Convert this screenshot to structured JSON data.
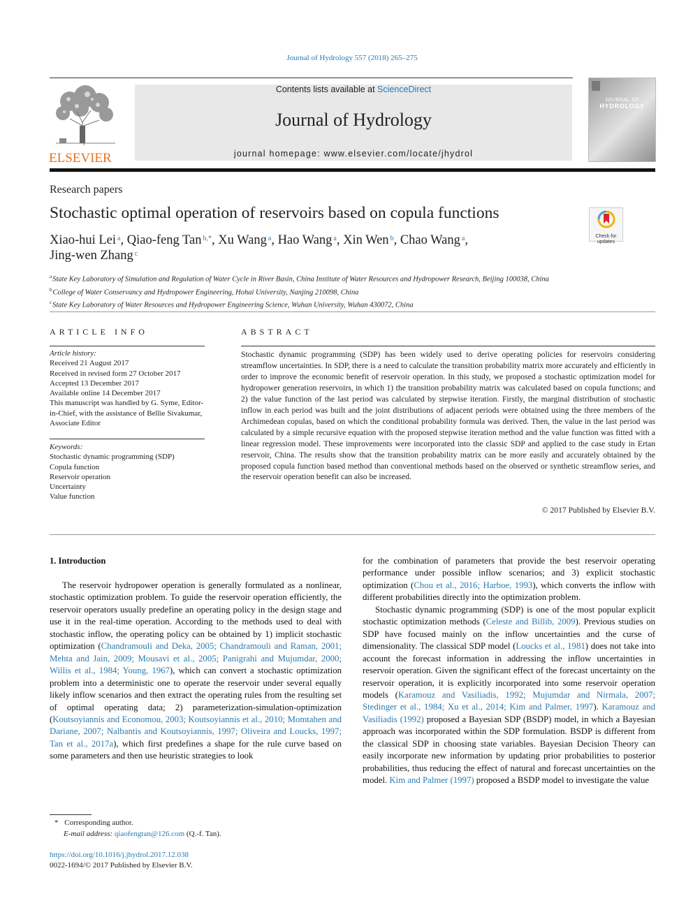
{
  "header": {
    "journal_ref": "Journal of Hydrology 557 (2018) 265–275",
    "contents_prefix": "Contents lists available at ",
    "contents_link": "ScienceDirect",
    "journal_title": "Journal of Hydrology",
    "homepage_prefix": "journal homepage: ",
    "homepage_url": "www.elsevier.com/locate/jhydrol",
    "publisher_logo_text": "ELSEVIER",
    "cover_title_line1": "JOURNAL OF",
    "cover_title_line2": "HYDROLOGY"
  },
  "article": {
    "section": "Research papers",
    "title": "Stochastic optimal operation of reservoirs based on copula functions",
    "crossmark_label": "Check for updates",
    "authors": [
      {
        "name": "Xiao-hui Lei",
        "aff": "a",
        "sep": ", "
      },
      {
        "name": "Qiao-feng Tan",
        "aff": "b,*",
        "sep": ", "
      },
      {
        "name": "Xu Wang",
        "aff": "a",
        "sep": ", "
      },
      {
        "name": "Hao Wang",
        "aff": "a",
        "sep": ", "
      },
      {
        "name": "Xin Wen",
        "aff": "b",
        "sep": ", "
      },
      {
        "name": "Chao Wang",
        "aff": "a",
        "sep": ","
      },
      {
        "name": "Jing-wen Zhang",
        "aff": "c",
        "sep": ""
      }
    ],
    "affiliations": [
      {
        "key": "a",
        "text": "State Key Laboratory of Simulation and Regulation of Water Cycle in River Basin, China Institute of Water Resources and Hydropower Research, Beijing 100038, China"
      },
      {
        "key": "b",
        "text": "College of Water Conservancy and Hydropower Engineering, Hohai University, Nanjing 210098, China"
      },
      {
        "key": "c",
        "text": "State Key Laboratory of Water Resources and Hydropower Engineering Science, Wuhan University, Wuhan 430072, China"
      }
    ]
  },
  "article_info": {
    "heading": "ARTICLE INFO",
    "history_label": "Article history:",
    "history": [
      "Received 21 August 2017",
      "Received in revised form 27 October 2017",
      "Accepted 13 December 2017",
      "Available online 14 December 2017",
      "This manuscript was handled by G. Syme, Editor-in-Chief, with the assistance of Bellie Sivakumar, Associate Editor"
    ],
    "keywords_label": "Keywords:",
    "keywords": [
      "Stochastic dynamic programming (SDP)",
      "Copula function",
      "Reservoir operation",
      "Uncertainty",
      "Value function"
    ]
  },
  "abstract": {
    "heading": "ABSTRACT",
    "text": "Stochastic dynamic programming (SDP) has been widely used to derive operating policies for reservoirs considering streamflow uncertainties. In SDP, there is a need to calculate the transition probability matrix more accurately and efficiently in order to improve the economic benefit of reservoir operation. In this study, we proposed a stochastic optimization model for hydropower generation reservoirs, in which 1) the transition probability matrix was calculated based on copula functions; and 2) the value function of the last period was calculated by stepwise iteration. Firstly, the marginal distribution of stochastic inflow in each period was built and the joint distributions of adjacent periods were obtained using the three members of the Archimedean copulas, based on which the conditional probability formula was derived. Then, the value in the last period was calculated by a simple recursive equation with the proposed stepwise iteration method and the value function was fitted with a linear regression model. These improvements were incorporated into the classic SDP and applied to the case study in Ertan reservoir, China. The results show that the transition probability matrix can be more easily and accurately obtained by the proposed copula function based method than conventional methods based on the observed or synthetic streamflow series, and the reservoir operation benefit can also be increased.",
    "copyright": "© 2017 Published by Elsevier B.V."
  },
  "intro": {
    "heading": "1. Introduction",
    "left_paragraph": [
      {
        "t": "The reservoir hydropower operation is generally formulated as a nonlinear, stochastic optimization problem. To guide the reservoir operation efficiently, the reservoir operators usually predefine an operating policy in the design stage and use it in the real-time operation. According to the methods used to deal with stochastic inflow, the operating policy can be obtained by 1) implicit stochastic optimization (",
        "link": false
      },
      {
        "t": "Chandramouli and Deka, 2005; Chandramouli and Raman, 2001; Mehta and Jain, 2009; Mousavi et al., 2005; Panigrahi and Mujumdar, 2000; Willis et al., 1984; Young, 1967",
        "link": true
      },
      {
        "t": "), which can convert a stochastic optimization problem into a deterministic one to operate the reservoir under several equally likely inflow scenarios and then extract the operating rules from the resulting set of optimal operating data; 2) parameterization-simulation-optimization (",
        "link": false
      },
      {
        "t": "Koutsoyiannis and Economou, 2003; Koutsoyiannis et al., 2010; Momtahen and Dariane, 2007; Nalbantis and Koutsoyiannis, 1997; Oliveira and Loucks, 1997; Tan et al., 2017a",
        "link": true
      },
      {
        "t": "), which first predefines a shape for the rule curve based on some parameters and then use heuristic strategies to look",
        "link": false
      }
    ],
    "right_paragraph1": [
      {
        "t": "for the combination of parameters that provide the best reservoir operating performance under possible inflow scenarios; and 3) explicit stochastic optimization (",
        "link": false
      },
      {
        "t": "Chou et al., 2016; Harboe, 1993",
        "link": true
      },
      {
        "t": "), which converts the inflow with different probabilities directly into the optimization problem.",
        "link": false
      }
    ],
    "right_paragraph2": [
      {
        "t": "Stochastic dynamic programming (SDP) is one of the most popular explicit stochastic optimization methods (",
        "link": false
      },
      {
        "t": "Celeste and Billib, 2009",
        "link": true
      },
      {
        "t": "). Previous studies on SDP have focused mainly on the inflow uncertainties and the curse of dimensionality. The classical SDP model (",
        "link": false
      },
      {
        "t": "Loucks et al., 1981",
        "link": true
      },
      {
        "t": ") does not take into account the forecast information in addressing the inflow uncertainties in reservoir operation. Given the significant effect of the forecast uncertainty on the reservoir operation, it is explicitly incorporated into some reservoir operation models (",
        "link": false
      },
      {
        "t": "Karamouz and Vasiliadis, 1992; Mujumdar and Nirmala, 2007; Stedinger et al., 1984; Xu et al., 2014; Kim and Palmer, 1997",
        "link": true
      },
      {
        "t": "). ",
        "link": false
      },
      {
        "t": "Karamouz and Vasiliadis (1992)",
        "link": true
      },
      {
        "t": " proposed a Bayesian SDP (BSDP) model, in which a Bayesian approach was incorporated within the SDP formulation. BSDP is different from the classical SDP in choosing state variables. Bayesian Decision Theory can easily incorporate new information by updating prior probabilities to posterior probabilities, thus reducing the effect of natural and forecast uncertainties on the model. ",
        "link": false
      },
      {
        "t": "Kim and Palmer (1997)",
        "link": true
      },
      {
        "t": " proposed a BSDP model to investigate the value",
        "link": false
      }
    ]
  },
  "footnote": {
    "marker": "*",
    "corresponding": "Corresponding author.",
    "email_label": "E-mail address: ",
    "email": "qiaofengtan@126.com",
    "email_suffix": " (Q.-f. Tan)."
  },
  "doi": {
    "url": "https://doi.org/10.1016/j.jhydrol.2017.12.038",
    "issn_line": "0022-1694/© 2017 Published by Elsevier B.V."
  }
}
